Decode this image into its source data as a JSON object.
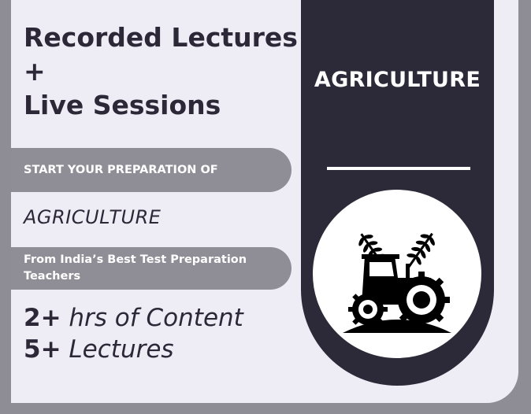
{
  "headline": {
    "line1": "Recorded Lectures",
    "line2": "+",
    "line3": "Live Sessions"
  },
  "prep_banner": "START YOUR PREPARATION OF",
  "subject": "AGRICULTURE",
  "teachers_banner": {
    "line1": "From India’s Best Test Preparation",
    "line2": "Teachers"
  },
  "stats": {
    "hours_value": "2+",
    "hours_label": "hrs of Content",
    "lectures_value": "5+",
    "lectures_label": "Lectures"
  },
  "panel": {
    "title": "AGRICULTURE",
    "icon": "tractor-icon"
  },
  "colors": {
    "background": "#8e8d95",
    "card": "#eeedf5",
    "dark": "#2c2a38",
    "pill": "#8f8e96",
    "white": "#ffffff"
  }
}
